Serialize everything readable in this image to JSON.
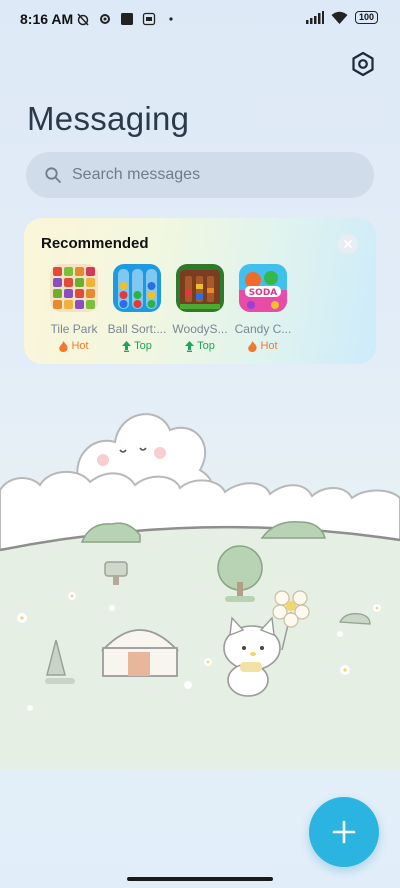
{
  "status_bar": {
    "time": "8:16 AM",
    "battery": "100"
  },
  "header": {
    "title": "Messaging"
  },
  "search": {
    "placeholder": "Search messages"
  },
  "recommended": {
    "title": "Recommended",
    "apps": [
      {
        "name": "Tile Park",
        "badge": "Hot",
        "badge_type": "hot"
      },
      {
        "name": "Ball Sort:...",
        "badge": "Top",
        "badge_type": "top"
      },
      {
        "name": "WoodyS...",
        "badge": "Top",
        "badge_type": "top"
      },
      {
        "name": "Candy C...",
        "badge": "Hot",
        "badge_type": "hot"
      }
    ],
    "candy_icon_text": "SODA"
  },
  "colors": {
    "accent": "#2cb4e0",
    "hot": "#ef7a2b",
    "top": "#22a35a"
  }
}
